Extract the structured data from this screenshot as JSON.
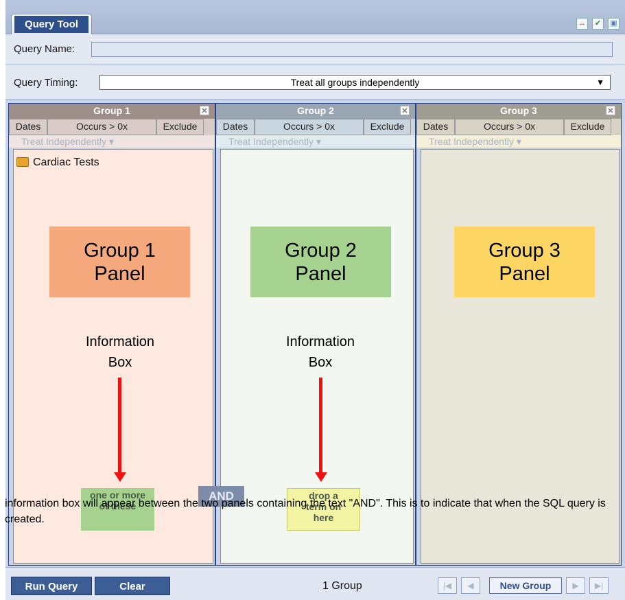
{
  "tab": {
    "label": "Query Tool"
  },
  "query_name": {
    "label": "Query Name:",
    "value": ""
  },
  "query_timing": {
    "label": "Query Timing:",
    "value": "Treat all groups independently"
  },
  "groups": [
    {
      "title": "Group 1",
      "dates": "Dates",
      "occurs": "Occurs > 0x",
      "exclude": "Exclude",
      "treat": "Treat Independently ▾",
      "item": "Cardiac Tests",
      "panel_label": "Group 1 Panel",
      "info": "Information Box",
      "drop_text": "one or more of these",
      "header_color": "#9e8f8b",
      "cells_color": "#d9cbc8",
      "treat_color": "#efe4e1",
      "body_color": "#fde9e0",
      "box_color": "#f5a97c"
    },
    {
      "title": "Group 2",
      "dates": "Dates",
      "occurs": "Occurs > 0x",
      "exclude": "Exclude",
      "treat": "Treat Independently ▾",
      "item": "",
      "panel_label": "Group 2 Panel",
      "info": "Information Box",
      "drop_text": "drop a term on here",
      "header_color": "#9aa5b2",
      "cells_color": "#c9d6e0",
      "treat_color": "#e2ebef",
      "body_color": "#f3f7f2",
      "box_color": "#a5d28e"
    },
    {
      "title": "Group 3",
      "dates": "Dates",
      "occurs": "Occurs > 0x",
      "exclude": "Exclude",
      "treat": "Treat Independently ▾",
      "item": "",
      "panel_label": "Group 3 Panel",
      "info": "",
      "drop_text": "",
      "header_color": "#a09e93",
      "cells_color": "#d6d3c5",
      "treat_color": "#f4efd8",
      "body_color": "#e8e6d8",
      "box_color": "#fdd562"
    }
  ],
  "and_label": "AND",
  "caption": "information box will appear between the two panels containing the text \"AND\". This is to indicate that when the SQL query is created.",
  "bottom": {
    "run": "Run Query",
    "clear": "Clear",
    "count": "1 Group",
    "new_group": "New Group"
  }
}
